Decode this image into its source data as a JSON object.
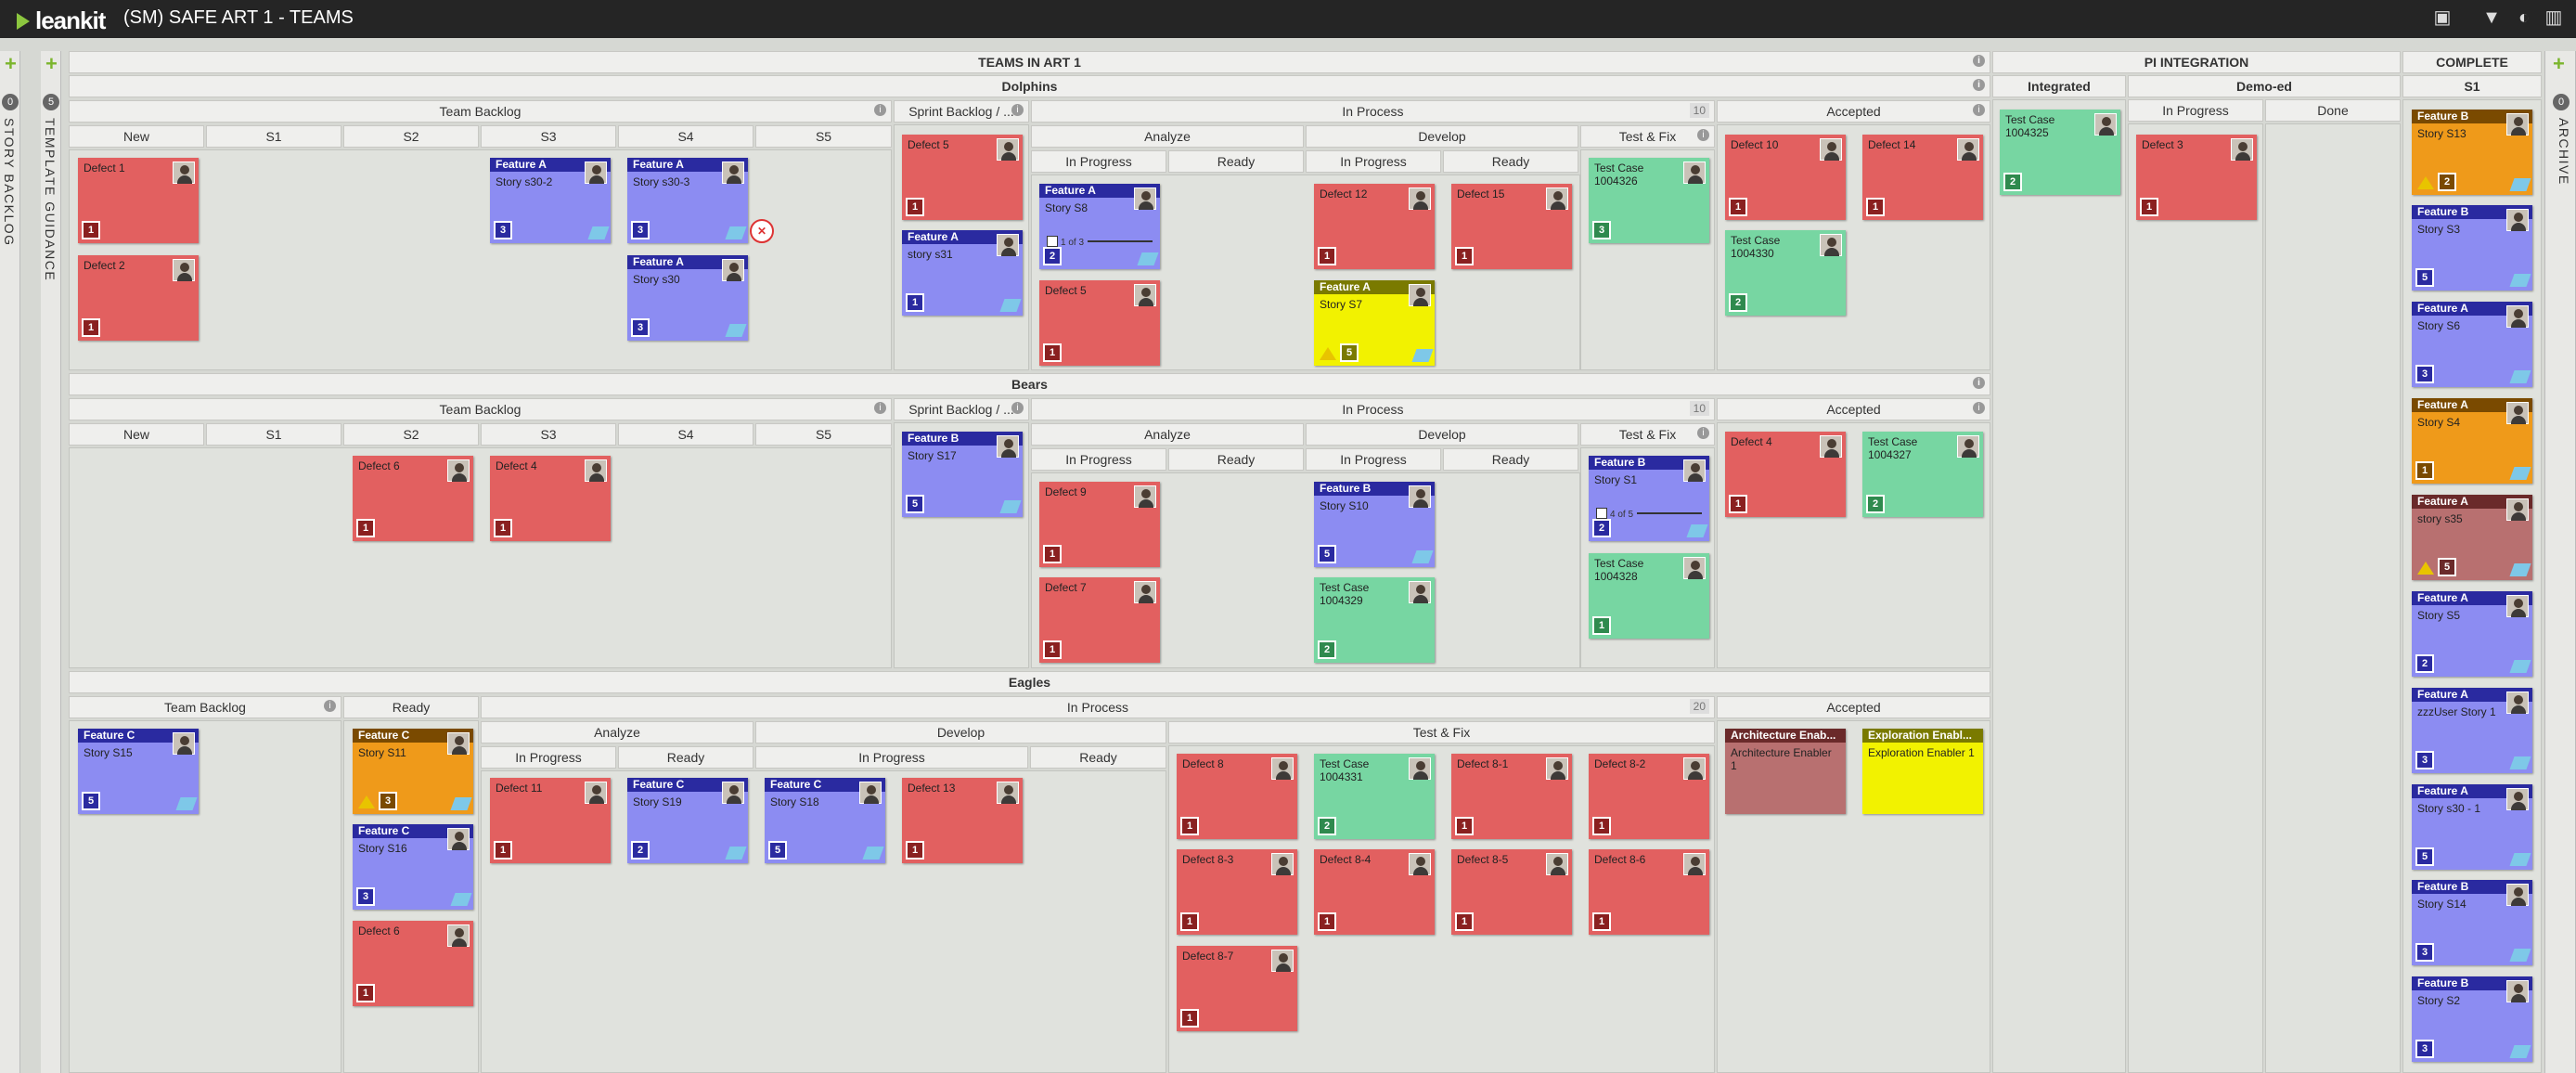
{
  "topbar": {
    "logo": "leankit",
    "board_title": "(SM) SAFE ART 1 - TEAMS",
    "icons": [
      "card-icon",
      "filter-icon",
      "user-icon",
      "chart-icon"
    ]
  },
  "left_lanes": {
    "story_backlog": "STORY BACKLOG",
    "story_backlog_count": "0",
    "template_guidance": "TEMPLATE GUIDANCE",
    "template_guidance_count": "5"
  },
  "right_lane": {
    "archive": "ARCHIVE",
    "archive_count": "0"
  },
  "headers": {
    "teams_in_art": "TEAMS IN ART 1",
    "pi_integration": "PI INTEGRATION",
    "complete": "COMPLETE",
    "integrated": "Integrated",
    "demo_ed": "Demo-ed",
    "in_progress": "In Progress",
    "done": "Done",
    "s1": "S1"
  },
  "dolphins": {
    "name": "Dolphins",
    "team_backlog": "Team Backlog",
    "sprint_backlog": "Sprint Backlog / ...",
    "in_process": "In Process",
    "in_process_wip": "10",
    "accepted": "Accepted",
    "analyze": "Analyze",
    "develop": "Develop",
    "test_fix": "Test & Fix",
    "in_progress": "In Progress",
    "ready": "Ready",
    "cols": [
      "New",
      "S1",
      "S2",
      "S3",
      "S4",
      "S5"
    ]
  },
  "bears": {
    "name": "Bears",
    "team_backlog": "Team Backlog",
    "sprint_backlog": "Sprint Backlog / ...",
    "in_process": "In Process",
    "in_process_wip": "10",
    "accepted": "Accepted",
    "analyze": "Analyze",
    "develop": "Develop",
    "test_fix": "Test & Fix",
    "in_progress": "In Progress",
    "ready": "Ready",
    "cols": [
      "New",
      "S1",
      "S2",
      "S3",
      "S4",
      "S5"
    ]
  },
  "eagles": {
    "name": "Eagles",
    "team_backlog": "Team Backlog",
    "ready_col": "Ready",
    "in_process": "In Process",
    "in_process_wip": "20",
    "accepted": "Accepted",
    "analyze": "Analyze",
    "develop": "Develop",
    "test_fix": "Test & Fix",
    "in_progress": "In Progress",
    "ready": "Ready"
  },
  "cards": [
    {
      "c": "red",
      "title": "Defect 1",
      "size": "1"
    },
    {
      "c": "red",
      "title": "Defect 2",
      "size": "1"
    },
    {
      "c": "blue",
      "cat": "Feature A",
      "title": "Story s30-2",
      "size": "3",
      "tag": true
    },
    {
      "c": "blue",
      "cat": "Feature A",
      "title": "Story s30-3",
      "size": "3",
      "tag": true,
      "blocked": true
    },
    {
      "c": "blue",
      "cat": "Feature A",
      "title": "Story s30",
      "size": "3",
      "tag": true
    },
    {
      "c": "red",
      "title": "Defect 5",
      "size": "1"
    },
    {
      "c": "blue",
      "cat": "Feature A",
      "title": "story s31",
      "size": "1",
      "tag": true
    },
    {
      "c": "blue",
      "cat": "Feature A",
      "title": "Story S8",
      "size": "2",
      "tag": true,
      "task": "1 of 3"
    },
    {
      "c": "red",
      "title": "Defect 5",
      "size": "1"
    },
    {
      "c": "red",
      "title": "Defect 12",
      "size": "1"
    },
    {
      "c": "red",
      "title": "Defect 15",
      "size": "1"
    },
    {
      "c": "yellow",
      "cat": "Feature A",
      "title": "Story S7",
      "size": "5",
      "tag": true,
      "warn": true
    },
    {
      "c": "green",
      "title": "Test Case 1004326",
      "size": "3"
    },
    {
      "c": "red",
      "title": "Defect 10",
      "size": "1"
    },
    {
      "c": "red",
      "title": "Defect 14",
      "size": "1"
    },
    {
      "c": "green",
      "title": "Test Case 1004330",
      "size": "2"
    },
    {
      "c": "green",
      "title": "Test Case 1004325",
      "size": "2"
    },
    {
      "c": "red",
      "title": "Defect 3",
      "size": "1"
    },
    {
      "c": "red",
      "title": "Defect 6",
      "size": "1"
    },
    {
      "c": "red",
      "title": "Defect 4",
      "size": "1"
    },
    {
      "c": "blue",
      "cat": "Feature B",
      "title": "Story S17",
      "size": "5",
      "tag": true
    },
    {
      "c": "red",
      "title": "Defect 9",
      "size": "1"
    },
    {
      "c": "red",
      "title": "Defect 7",
      "size": "1"
    },
    {
      "c": "blue",
      "cat": "Feature B",
      "title": "Story S10",
      "size": "5",
      "tag": true
    },
    {
      "c": "green",
      "title": "Test Case 1004329",
      "size": "2"
    },
    {
      "c": "blue",
      "cat": "Feature B",
      "title": "Story S1",
      "size": "2",
      "tag": true,
      "task": "4 of 5"
    },
    {
      "c": "green",
      "title": "Test Case 1004328",
      "size": "1"
    },
    {
      "c": "red",
      "title": "Defect 4",
      "size": "1"
    },
    {
      "c": "green",
      "title": "Test Case 1004327",
      "size": "2"
    },
    {
      "c": "blue",
      "cat": "Feature C",
      "title": "Story S15",
      "size": "5",
      "tag": true
    },
    {
      "c": "orange",
      "cat": "Feature C",
      "title": "Story S11",
      "size": "3",
      "tag": true,
      "warn": true
    },
    {
      "c": "blue",
      "cat": "Feature C",
      "title": "Story S16",
      "size": "3",
      "tag": true
    },
    {
      "c": "red",
      "title": "Defect 6",
      "size": "1"
    },
    {
      "c": "red",
      "title": "Defect 11",
      "size": "1"
    },
    {
      "c": "blue",
      "cat": "Feature C",
      "title": "Story S19",
      "size": "2",
      "tag": true
    },
    {
      "c": "blue",
      "cat": "Feature C",
      "title": "Story S18",
      "size": "5",
      "tag": true
    },
    {
      "c": "red",
      "title": "Defect 13",
      "size": "1"
    },
    {
      "c": "red",
      "title": "Defect 8",
      "size": "1"
    },
    {
      "c": "green",
      "title": "Test Case 1004331",
      "size": "2"
    },
    {
      "c": "red",
      "title": "Defect 8-1",
      "size": "1"
    },
    {
      "c": "red",
      "title": "Defect 8-2",
      "size": "1"
    },
    {
      "c": "red",
      "title": "Defect 8-3",
      "size": "1"
    },
    {
      "c": "red",
      "title": "Defect 8-4",
      "size": "1"
    },
    {
      "c": "red",
      "title": "Defect 8-5",
      "size": "1"
    },
    {
      "c": "red",
      "title": "Defect 8-6",
      "size": "1"
    },
    {
      "c": "red",
      "title": "Defect 8-7",
      "size": "1"
    },
    {
      "c": "mauve",
      "cat": "Architecture Enab...",
      "title": "Architecture Enabler 1",
      "noav": true,
      "nosz": true
    },
    {
      "c": "yellow",
      "cat": "Exploration Enabl...",
      "title": "Exploration Enabler 1",
      "noav": true,
      "nosz": true
    },
    {
      "c": "orange",
      "cat": "Feature B",
      "title": "Story S13",
      "size": "2",
      "tag": true,
      "warn": true
    },
    {
      "c": "blue",
      "cat": "Feature B",
      "title": "Story S3",
      "size": "5",
      "tag": true
    },
    {
      "c": "blue",
      "cat": "Feature A",
      "title": "Story S6",
      "size": "3",
      "tag": true
    },
    {
      "c": "orange",
      "cat": "Feature A",
      "title": "Story S4",
      "size": "1",
      "tag": true
    },
    {
      "c": "mauve",
      "cat": "Feature A",
      "title": "story s35",
      "size": "5",
      "tag": true,
      "warn": true
    },
    {
      "c": "blue",
      "cat": "Feature A",
      "title": "Story S5",
      "size": "2",
      "tag": true
    },
    {
      "c": "blue",
      "cat": "Feature A",
      "title": "zzzUser Story 1",
      "size": "3",
      "tag": true
    },
    {
      "c": "blue",
      "cat": "Feature A",
      "title": "Story s30 - 1",
      "size": "5",
      "tag": true
    },
    {
      "c": "blue",
      "cat": "Feature B",
      "title": "Story S14",
      "size": "3",
      "tag": true
    },
    {
      "c": "blue",
      "cat": "Feature B",
      "title": "Story S2",
      "size": "3",
      "tag": true
    }
  ]
}
